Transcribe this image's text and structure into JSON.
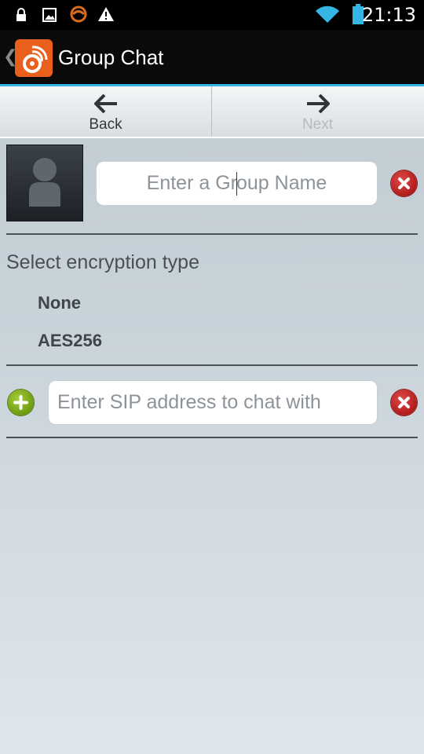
{
  "status_bar": {
    "time": "21:13",
    "icons": [
      "lock-icon",
      "image-icon",
      "app-notification-icon",
      "warning-icon",
      "wifi-icon",
      "battery-icon"
    ]
  },
  "action_bar": {
    "title": "Group Chat",
    "up_glyph": "❮",
    "accent_color": "#33b5e5"
  },
  "nav": {
    "back_label": "Back",
    "next_label": "Next"
  },
  "group": {
    "name_before_cursor": "Enter a Gr",
    "name_after_cursor": "oup Name"
  },
  "encryption": {
    "title": "Select encryption type",
    "options": [
      "None",
      "AES256"
    ]
  },
  "sip": {
    "placeholder": "Enter SIP address to chat with"
  },
  "colors": {
    "clear_button": "#c62828",
    "add_button": "#8bc34a"
  }
}
